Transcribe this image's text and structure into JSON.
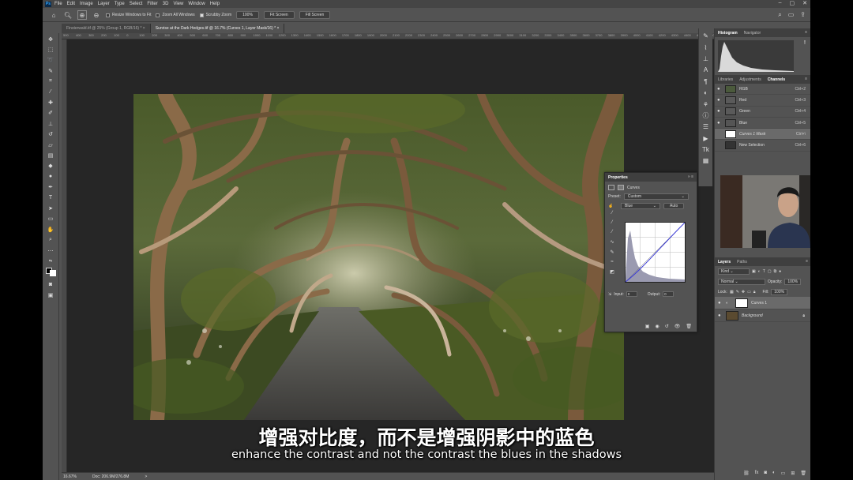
{
  "menubar": {
    "app_logo": "Ps",
    "items": [
      "File",
      "Edit",
      "Image",
      "Layer",
      "Type",
      "Select",
      "Filter",
      "3D",
      "View",
      "Window",
      "Help"
    ],
    "window_controls": [
      "minimize-icon",
      "maximize-icon",
      "close-icon"
    ]
  },
  "options_bar": {
    "resize_windows_label": "Resize Windows to Fit",
    "resize_windows_checked": false,
    "zoom_all_label": "Zoom All Windows",
    "zoom_all_checked": false,
    "scrubby_zoom_label": "Scrubby Zoom",
    "scrubby_zoom_checked": true,
    "zoom_100_label": "100%",
    "fit_screen_label": "Fit Screen",
    "fill_screen_label": "Fill Screen"
  },
  "document_tabs": [
    {
      "label": "Finsterwald.tif @ 25% (Group 1, RGB/16) *",
      "close": "×",
      "active": false
    },
    {
      "label": "Sunrise at the Dark Hedges.tif @ 16.7% (Curves 1, Layer Mask/16) *",
      "close": "×",
      "active": true
    }
  ],
  "ruler_numbers": [
    "500",
    "400",
    "300",
    "200",
    "100",
    "0",
    "100",
    "200",
    "300",
    "400",
    "500",
    "600",
    "700",
    "800",
    "900",
    "1000",
    "1100",
    "1200",
    "1300",
    "1400",
    "1500",
    "1600",
    "1700",
    "1800",
    "1900",
    "2000",
    "2100",
    "2200",
    "2300",
    "2400",
    "2500",
    "2600",
    "2700",
    "2800",
    "2900",
    "3000",
    "3100",
    "3200",
    "3300",
    "3400",
    "3500",
    "3600",
    "3700",
    "3800",
    "3900",
    "4000",
    "4100",
    "4200",
    "4300",
    "4400",
    "4500",
    "4600",
    "4700"
  ],
  "status_bar": {
    "zoom": "16.67%",
    "doc": "Doc: 206.9M/276.8M",
    "arrow": ">"
  },
  "histogram_panel": {
    "tabs": [
      "Histogram",
      "Navigator"
    ],
    "active_tab": "Histogram",
    "warning_icon": "!"
  },
  "channels_panel": {
    "tabs": [
      "Libraries",
      "Adjustments",
      "Channels"
    ],
    "active_tab": "Channels",
    "rows": [
      {
        "name": "RGB",
        "shortcut": "Ctrl+2",
        "thumb": "image",
        "selected": false
      },
      {
        "name": "Red",
        "shortcut": "Ctrl+3",
        "thumb": "image",
        "selected": false
      },
      {
        "name": "Green",
        "shortcut": "Ctrl+4",
        "thumb": "image",
        "selected": false
      },
      {
        "name": "Blue",
        "shortcut": "Ctrl+5",
        "thumb": "image",
        "selected": false
      },
      {
        "name": "Curves 1 Mask",
        "shortcut": "Ctrl+\\",
        "thumb": "white",
        "selected": true
      },
      {
        "name": "New Selection",
        "shortcut": "Ctrl+6",
        "thumb": "image",
        "selected": false
      }
    ]
  },
  "properties_panel": {
    "title": "Properties",
    "adjustment_label": "Curves",
    "preset_label": "Preset:",
    "preset_value": "Custom",
    "channel_value": "Blue",
    "auto_label": "Auto",
    "input_label": "Input:",
    "input_value": "0",
    "output_label": "Output:",
    "output_value": "0",
    "curve_channel_color": "#3b3bd6"
  },
  "layers_panel": {
    "tabs": [
      "Layers",
      "Paths"
    ],
    "active_tab": "Layers",
    "kind_label": "Kind",
    "blend_mode": "Normal",
    "opacity_label": "Opacity:",
    "opacity_value": "100%",
    "lock_label": "Lock:",
    "fill_label": "Fill:",
    "fill_value": "100%",
    "layers": [
      {
        "name": "Curves 1",
        "selected": true
      },
      {
        "name": "Background",
        "selected": false
      }
    ]
  },
  "subtitles": {
    "chinese": "增强对比度，而不是增强阴影中的蓝色",
    "english": "enhance the contrast and not the contrast the blues in the shadows"
  }
}
